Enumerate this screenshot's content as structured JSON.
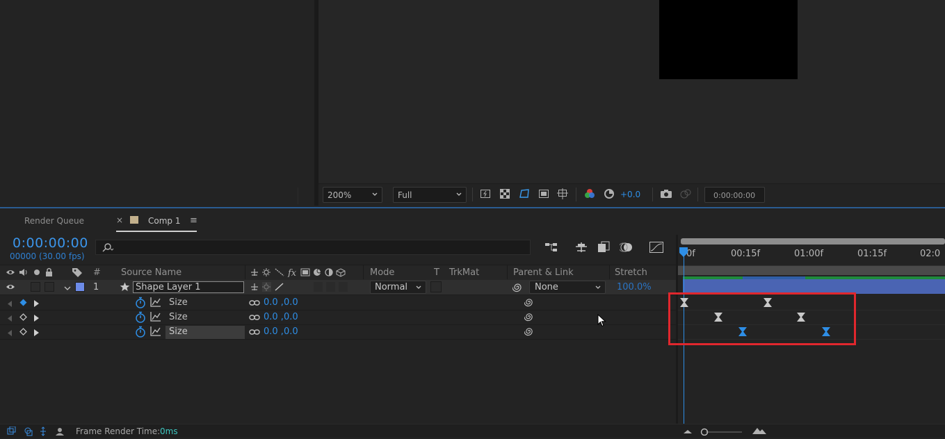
{
  "viewer": {
    "zoom": "200%",
    "resolution": "Full",
    "exposure": "+0.0",
    "timecode": "0:00:00:00"
  },
  "tabs": [
    {
      "label": "Render Queue"
    },
    {
      "label": "Comp 1"
    }
  ],
  "comp": {
    "current_time": "0:00:00:00",
    "frame_info": "00000 (30.00 fps)"
  },
  "columns": {
    "hash": "#",
    "source_name": "Source Name",
    "mode": "Mode",
    "t": "T",
    "trkmat": "TrkMat",
    "parent_link": "Parent & Link",
    "stretch": "Stretch"
  },
  "layer": {
    "number": "1",
    "name": "Shape Layer 1",
    "mode": "Normal",
    "parent": "None",
    "stretch": "100.0%",
    "label_color": "#6d8be8"
  },
  "properties": [
    {
      "name": "Size",
      "value": "0.0 ,0.0"
    },
    {
      "name": "Size",
      "value": "0.0 ,0.0"
    },
    {
      "name": "Size",
      "value": "0.0 ,0.0"
    }
  ],
  "ruler": {
    "ticks": [
      "0f",
      "00:15f",
      "01:00f",
      "01:15f",
      "02:0"
    ]
  },
  "status": {
    "label": "Frame Render Time:",
    "value": "0ms"
  },
  "colors": {
    "accent": "#2e8ee6",
    "highlight_box": "#e0272d",
    "layer_bar": "#4a64b3"
  }
}
